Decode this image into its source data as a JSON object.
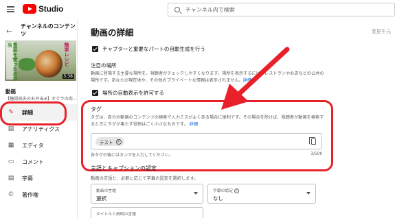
{
  "header": {
    "logo_text": "Studio",
    "search_placeholder": "チャンネル内で検索"
  },
  "sidebar": {
    "back_icon": "←",
    "channel_title": "チャンネルのコンテンツ",
    "thumbnail": {
      "text_left": "青菜を使ったお弁当",
      "text_right": "簡単レシピ",
      "duration": "5:38"
    },
    "video_label": "動画",
    "video_title": "【糖尿病夫のお弁当#】オクラの肉...",
    "items": [
      {
        "label": "詳細",
        "icon": "pencil-icon",
        "glyph": "✎"
      },
      {
        "label": "アナリティクス",
        "icon": "analytics-icon",
        "glyph": "▤"
      },
      {
        "label": "エディタ",
        "icon": "editor-icon",
        "glyph": "▦"
      },
      {
        "label": "コメント",
        "icon": "comment-icon",
        "glyph": "▭"
      },
      {
        "label": "字幕",
        "icon": "subtitles-icon",
        "glyph": "▤"
      },
      {
        "label": "著作権",
        "icon": "copyright-icon",
        "glyph": "©"
      }
    ]
  },
  "main": {
    "title": "動画の詳細",
    "undo_label": "変更を元",
    "chapter_checkbox": "チャプターと重要なパートの自動生成を行う",
    "places": {
      "title": "注目の場所",
      "desc_line1": "動画に登場する主要な場所を、視聴者がチェックしやすくなります。場所を表示するには、レストランやお店などの公共の",
      "desc_line2_prefix": "場所です。あなたの現在地や、その他のプライベートな情報は表示されません。",
      "desc_link": "詳細",
      "checkbox": "場所の自動表示を許可する"
    },
    "tags": {
      "title": "タグ",
      "desc": "タグは、自分の動画のコンテンツの検索で入力ミスがよくある場合に便利です。その場合を除けば、視聴者が動画を検索するときにタグが果たす役割はごく小さなものです。",
      "desc_link": "詳細",
      "chip": "テスト",
      "hint": "各タグの後にはカンマを入力してください。",
      "count": "3/500"
    },
    "language": {
      "title": "言語とキャプションの認定",
      "desc": "動画の言語と、必要に応じて字幕の認定を選択します。",
      "video_language_label": "動画の言語",
      "video_language_value": "選択",
      "caption_cert_label": "字幕の認定",
      "caption_cert_value": "なし",
      "title_desc_language_label": "タイトルと説明の言語"
    }
  },
  "colors": {
    "brand_red": "#ff0000",
    "annotation_red": "#e8202a",
    "link_blue": "#065fd4"
  }
}
